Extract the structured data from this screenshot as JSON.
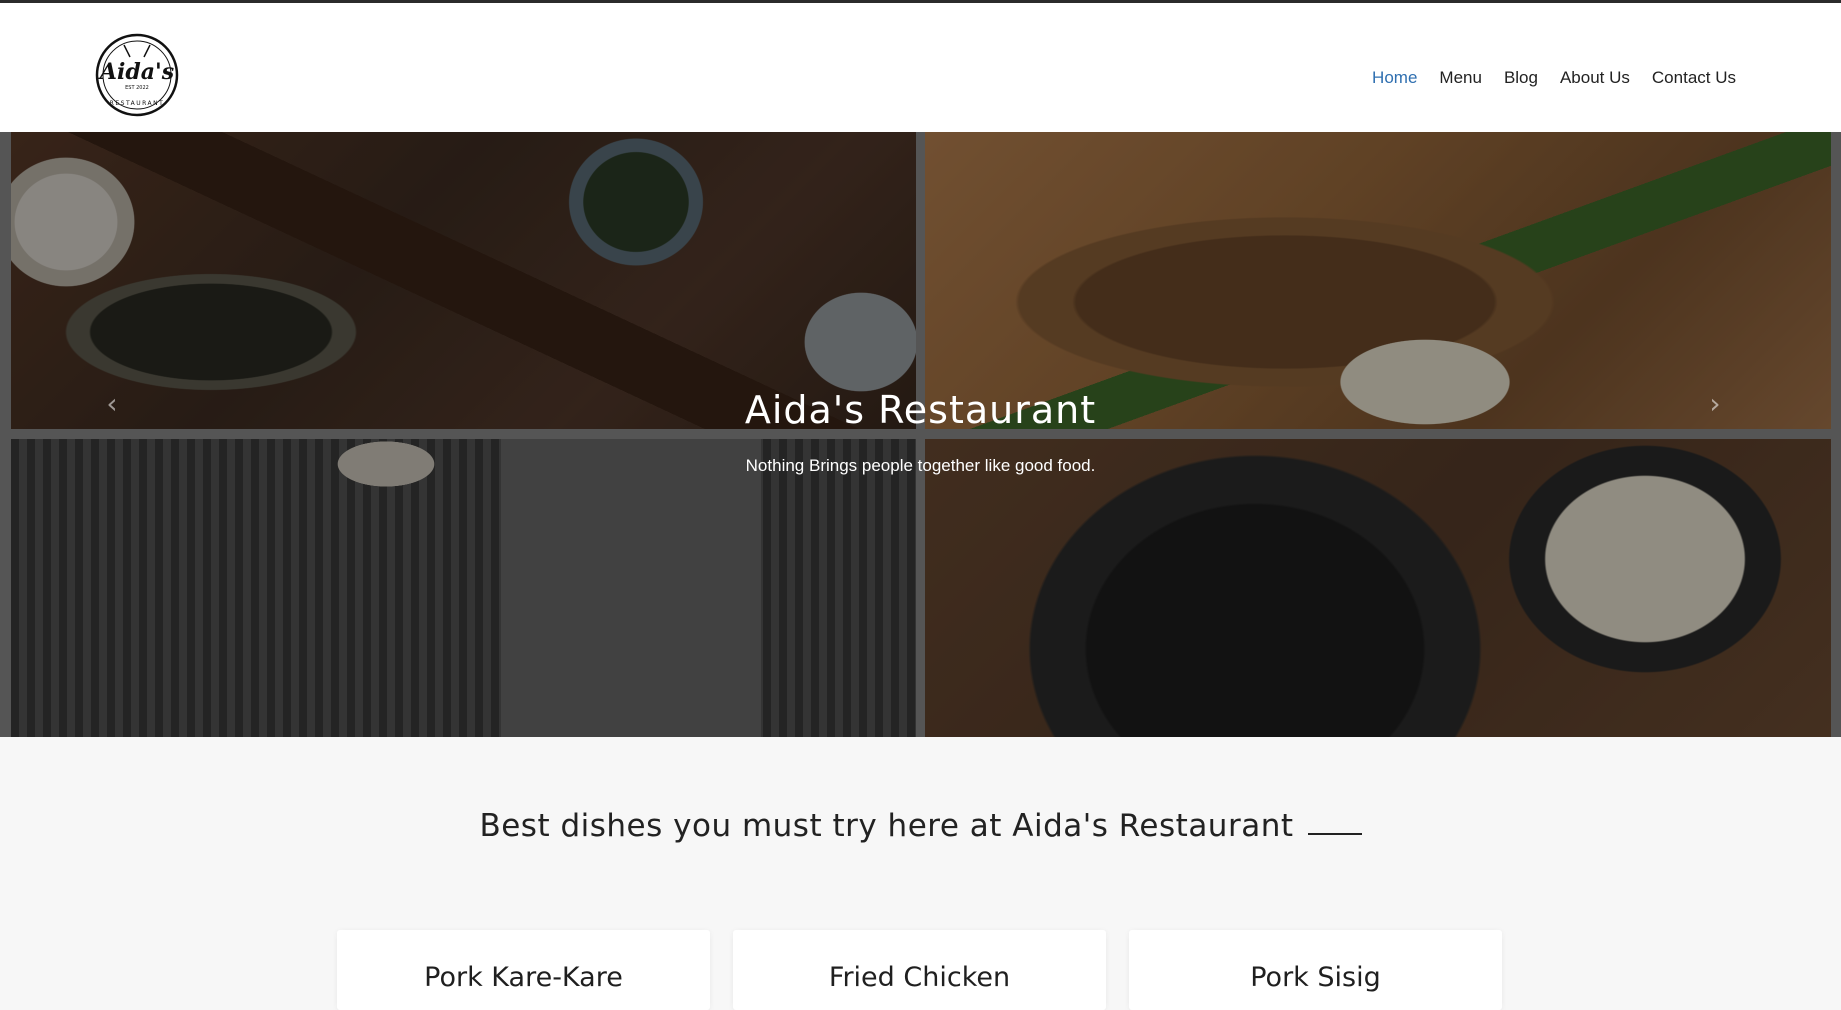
{
  "header": {
    "logo": {
      "icon": "aidas-restaurant-logo",
      "brand": "Aida's",
      "est": "EST 2022",
      "subtitle": "RESTAURANT"
    },
    "nav": [
      {
        "label": "Home",
        "active": true
      },
      {
        "label": "Menu",
        "active": false
      },
      {
        "label": "Blog",
        "active": false
      },
      {
        "label": "About Us",
        "active": false
      },
      {
        "label": "Contact Us",
        "active": false
      }
    ],
    "active_color": "#2f6fb0"
  },
  "hero": {
    "title": "Aida's Restaurant",
    "subtitle": "Nothing Brings people together like good food.",
    "prev_icon": "chevron-left-icon",
    "next_icon": "chevron-right-icon",
    "prev_glyph": "‹",
    "next_glyph": "›"
  },
  "section": {
    "heading": "Best dishes you must try here at Aida's Restaurant"
  },
  "dishes": [
    {
      "title": "Pork Kare-Kare"
    },
    {
      "title": "Fried Chicken"
    },
    {
      "title": "Pork Sisig"
    }
  ]
}
